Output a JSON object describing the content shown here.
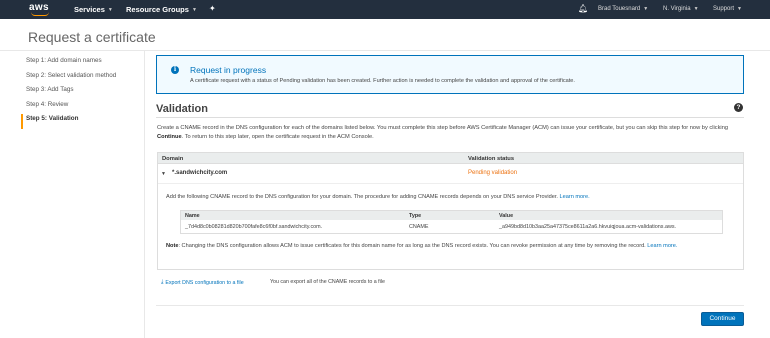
{
  "topnav": {
    "logo": "aws",
    "services": "Services",
    "resource_groups": "Resource Groups",
    "user": "Brad Touesnard",
    "region": "N. Virginia",
    "support": "Support"
  },
  "page_title": "Request a certificate",
  "steps": [
    "Step 1: Add domain names",
    "Step 2: Select validation method",
    "Step 3: Add Tags",
    "Step 4: Review",
    "Step 5: Validation"
  ],
  "info": {
    "title": "Request in progress",
    "text": "A certificate request with a status of Pending validation has been created. Further action is needed to complete the validation and approval of the certificate."
  },
  "validation": {
    "title": "Validation",
    "desc_a": "Create a CNAME record in the DNS configuration for each of the domains listed below. You must complete this step before AWS Certificate Manager (ACM) can issue your certificate, but you can skip this step for now by clicking ",
    "desc_b": "Continue",
    "desc_c": ". To return to this step later, open the certificate request in the ACM Console."
  },
  "table": {
    "col_domain": "Domain",
    "col_status": "Validation status",
    "domain": "*.sandwichcity.com",
    "status": "Pending validation",
    "add_text": "Add the following CNAME record to the DNS configuration for your domain. The procedure for adding CNAME records depends on your DNS service Provider. ",
    "learn_more": "Learn more.",
    "inner": {
      "col_name": "Name",
      "col_type": "Type",
      "col_value": "Value",
      "name": "_7d4d8c0b08281d820b700fafe8c6f0bf.sandwichcity.com.",
      "type": "CNAME",
      "value": "_a949bd8d10b3aa25a47375ce8611a2a6.hkvuiqjoua.acm-validations.aws."
    },
    "note_label": "Note",
    "note_text": ": Changing the DNS configuration allows ACM to issue certificates for this domain name for as long as the DNS record exists. You can revoke permission at any time by removing the record. ",
    "note_link": "Learn more."
  },
  "export": {
    "link": "Export DNS configuration to a file",
    "help": "You can export all of the CNAME records to a file"
  },
  "continue_label": "Continue"
}
